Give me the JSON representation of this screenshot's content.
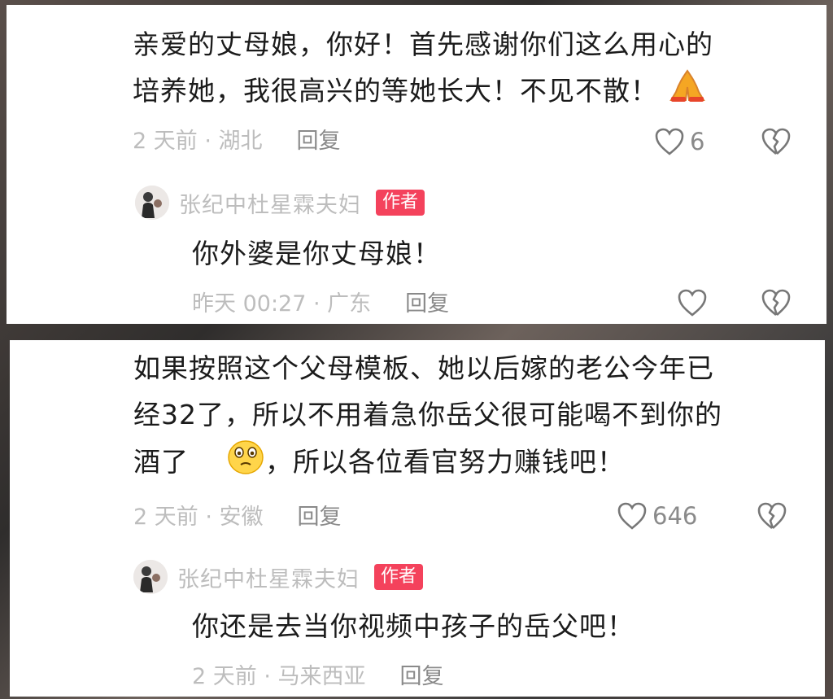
{
  "comments": [
    {
      "lines": [
        "亲爱的丈母娘，你好！首先感谢你们这么用心的",
        "培养她，我很高兴的等她长大！不见不散！"
      ],
      "emoji": "pray-emoji",
      "meta": "2 天前 · 湖北",
      "reply_label": "回复",
      "likes": "6",
      "author_reply": {
        "author": "张纪中杜星霖夫妇",
        "badge": "作者",
        "text": "你外婆是你丈母娘！",
        "meta": "昨天 00:27 · 广东",
        "reply_label": "回复"
      }
    },
    {
      "lines": [
        "如果按照这个父母模板、她以后嫁的老公今年已",
        "经32了，所以不用着急你岳父很可能喝不到你的",
        "酒了"
      ],
      "line3_rest": "，所以各位看官努力赚钱吧！",
      "emoji": "worried-face-emoji",
      "meta": "2 天前 · 安徽",
      "reply_label": "回复",
      "likes": "646",
      "author_reply": {
        "author": "张纪中杜星霖夫妇",
        "badge": "作者",
        "text": "你还是去当你视频中孩子的岳父吧！",
        "meta": "2 天前 · 马来西亚",
        "reply_label": "回复"
      }
    }
  ],
  "colors": {
    "badge": "#f4425c",
    "meta_text": "#bdbdbd",
    "body_text": "#1b1b1b"
  }
}
